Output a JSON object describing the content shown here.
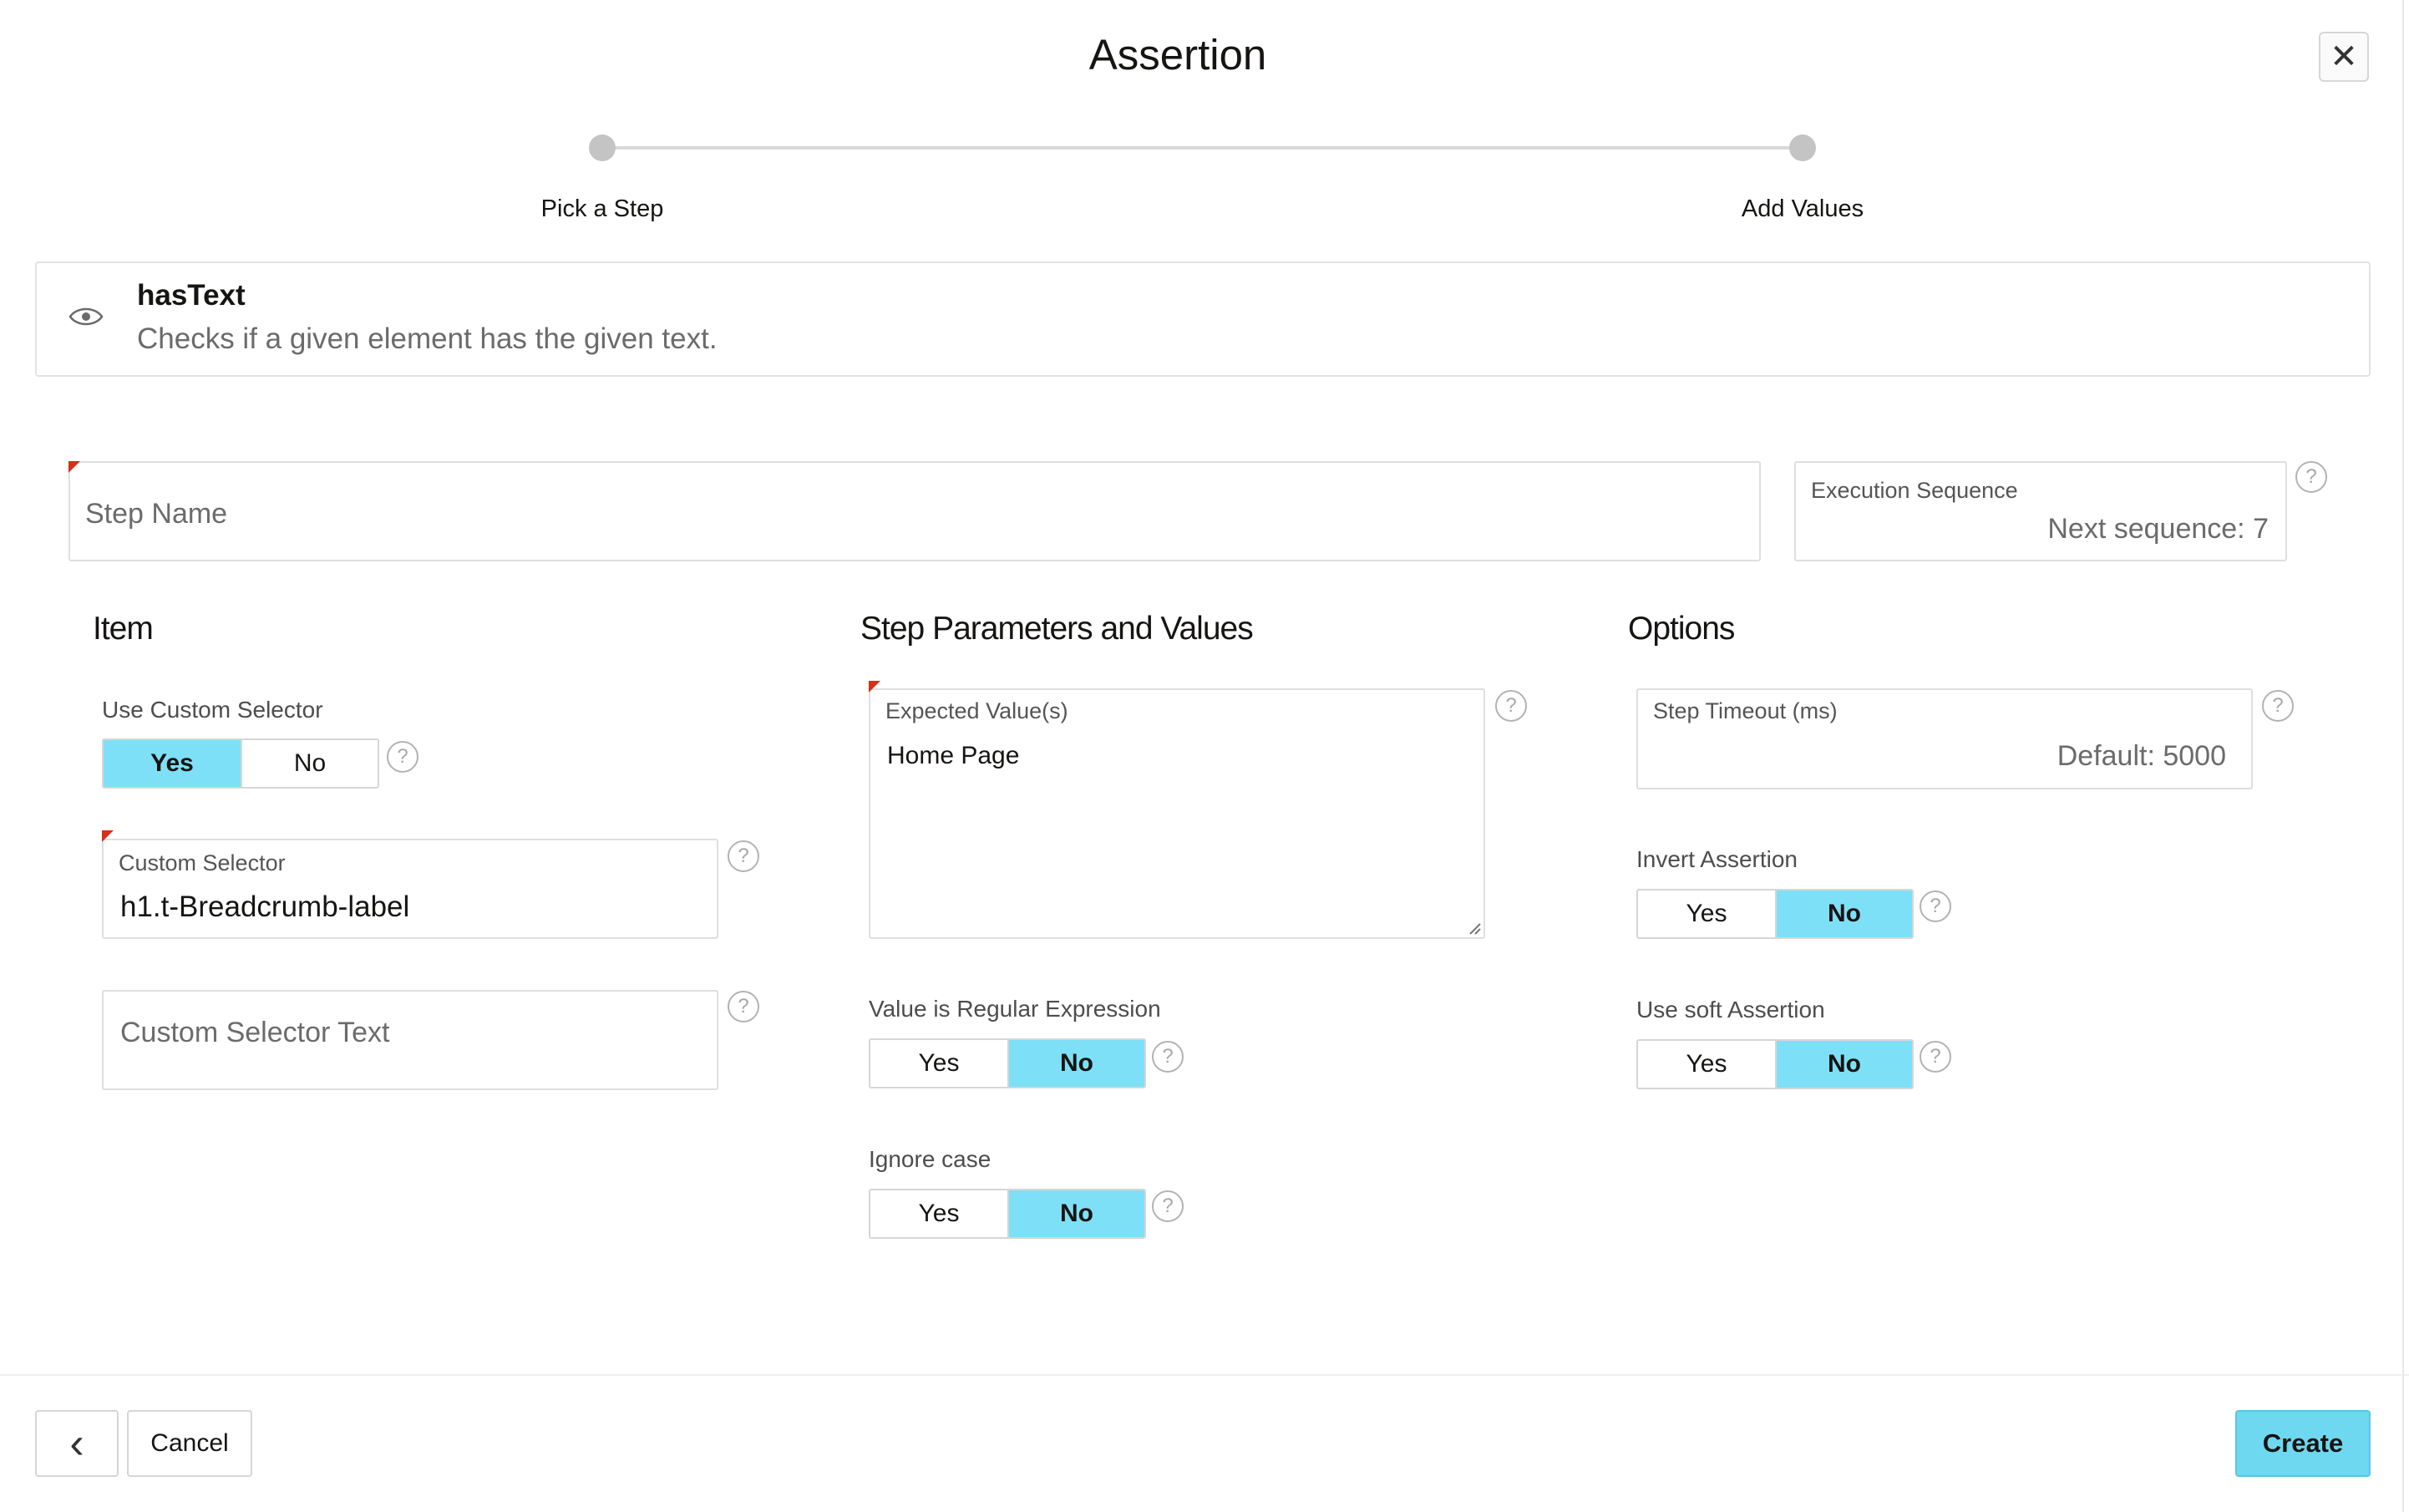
{
  "dialog": {
    "title": "Assertion",
    "close_symbol": "✕"
  },
  "train": {
    "steps": [
      {
        "label": "Pick a Step"
      },
      {
        "label": "Add Values"
      }
    ]
  },
  "info": {
    "title": "hasText",
    "description": "Checks if a given element has the given text."
  },
  "step_name": {
    "placeholder": "Step Name"
  },
  "execution_sequence": {
    "label": "Execution Sequence",
    "value": "Next sequence: 7"
  },
  "sections": {
    "item": "Item",
    "params": "Step Parameters and Values",
    "options": "Options"
  },
  "item": {
    "use_custom_selector": {
      "label": "Use Custom Selector",
      "yes": "Yes",
      "no": "No",
      "selected": "Yes"
    },
    "custom_selector": {
      "label": "Custom Selector",
      "value": "h1.t-Breadcrumb-label"
    },
    "custom_selector_text": {
      "placeholder": "Custom Selector Text"
    }
  },
  "params": {
    "expected_values": {
      "label": "Expected Value(s)",
      "value": "Home Page"
    },
    "value_is_regex": {
      "label": "Value is Regular Expression",
      "yes": "Yes",
      "no": "No",
      "selected": "No"
    },
    "ignore_case": {
      "label": "Ignore case",
      "yes": "Yes",
      "no": "No",
      "selected": "No"
    }
  },
  "options": {
    "step_timeout": {
      "label": "Step Timeout (ms)",
      "value": "Default: 5000"
    },
    "invert_assertion": {
      "label": "Invert Assertion",
      "yes": "Yes",
      "no": "No",
      "selected": "No"
    },
    "soft_assertion": {
      "label": "Use soft Assertion",
      "yes": "Yes",
      "no": "No",
      "selected": "No"
    }
  },
  "help_symbol": "?",
  "footer": {
    "back_symbol": "‹",
    "cancel_label": "Cancel",
    "create_label": "Create"
  },
  "colors": {
    "toggle_selected": "#7ee0f6",
    "primary_button": "#6fd8f1",
    "required_marker": "#d6301a"
  },
  "icons": [
    "close-icon",
    "eye-icon",
    "help-icon",
    "chevron-left-icon",
    "resize-grip-icon"
  ]
}
